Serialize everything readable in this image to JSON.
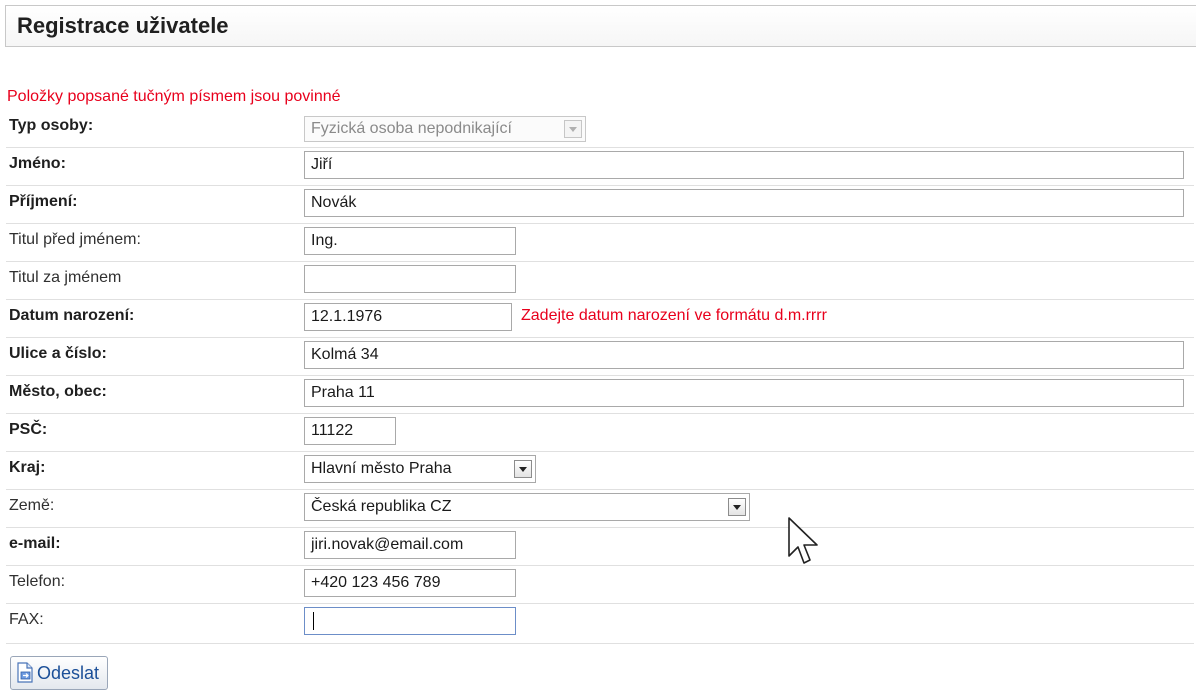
{
  "page": {
    "title": "Registrace uživatele"
  },
  "form": {
    "required_note": "Položky popsané tučným písmem jsou povinné",
    "fields": {
      "person_type": {
        "label": "Typ osoby:",
        "value": "Fyzická osoba nepodnikající"
      },
      "first_name": {
        "label": "Jméno:",
        "value": "Jiří"
      },
      "last_name": {
        "label": "Příjmení:",
        "value": "Novák"
      },
      "title_before": {
        "label": "Titul před jménem:",
        "value": "Ing."
      },
      "title_after": {
        "label": "Titul za jménem",
        "value": ""
      },
      "birth_date": {
        "label": "Datum narození:",
        "value": "12.1.1976",
        "hint": "Zadejte datum narození ve formátu d.m.rrrr"
      },
      "street": {
        "label": "Ulice a číslo:",
        "value": "Kolmá 34"
      },
      "city": {
        "label": "Město, obec:",
        "value": "Praha 11"
      },
      "zip": {
        "label": "PSČ:",
        "value": "11122"
      },
      "region": {
        "label": "Kraj:",
        "value": "Hlavní město Praha"
      },
      "country": {
        "label": "Země:",
        "value": "Česká republika CZ"
      },
      "email": {
        "label": "e-mail:",
        "value": "jiri.novak@email.com"
      },
      "phone": {
        "label": "Telefon:",
        "value": "+420 123 456 789"
      },
      "fax": {
        "label": "FAX:",
        "value": ""
      }
    },
    "submit_label": "Odeslat"
  },
  "colors": {
    "required_text": "#e8001c",
    "submit_text": "#1b4f98",
    "focus_border": "#6c8ec8"
  },
  "icons": {
    "submit": "document-send-icon",
    "dropdown": "chevron-down-icon",
    "pointer": "mouse-cursor-icon"
  }
}
